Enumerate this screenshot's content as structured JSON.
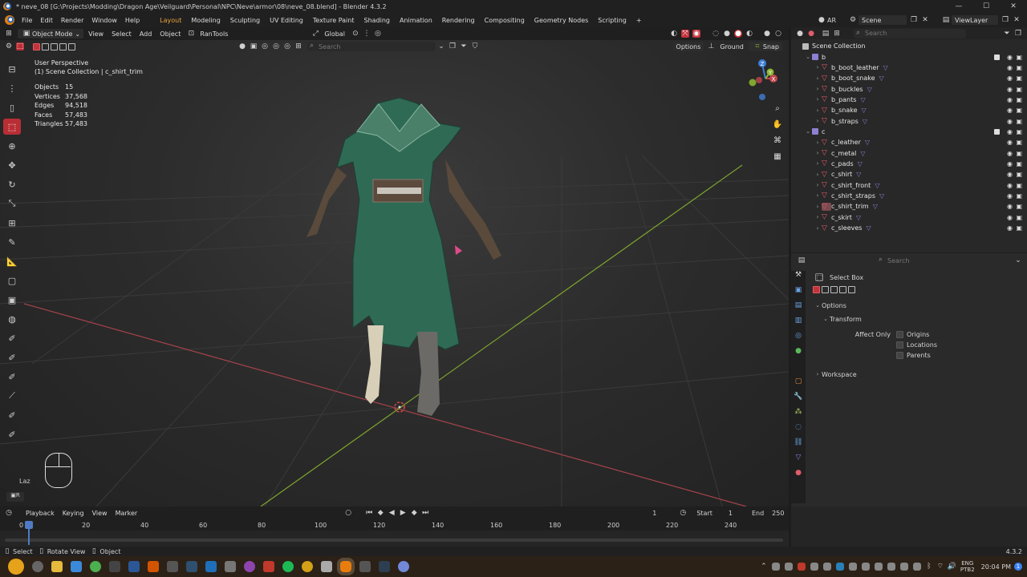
{
  "window": {
    "title": "* neve_08 [G:\\Projects\\Modding\\Dragon Age\\Veilguard\\Personal\\NPC\\Neve\\armor\\08\\neve_08.blend] - Blender 4.3.2",
    "min": "—",
    "max": "☐",
    "close": "✕"
  },
  "menu": [
    "File",
    "Edit",
    "Render",
    "Window",
    "Help"
  ],
  "workspaces": [
    "Layout",
    "Modeling",
    "Sculpting",
    "UV Editing",
    "Texture Paint",
    "Shading",
    "Animation",
    "Rendering",
    "Compositing",
    "Geometry Nodes",
    "Scripting"
  ],
  "active_workspace": "Layout",
  "add_workspace": "+",
  "scene": {
    "ar": "AR",
    "name": "Scene",
    "view_layer": "ViewLayer"
  },
  "viewport_header": {
    "mode": "Object Mode",
    "menus": [
      "View",
      "Select",
      "Add",
      "Object"
    ],
    "addon": "RanTools",
    "orientation": "Global",
    "options": "Options",
    "ground": "Ground",
    "snap": "Snap",
    "search_placeholder": "Search"
  },
  "overlay": {
    "view": "User Perspective",
    "collection": "(1) Scene Collection | c_shirt_trim"
  },
  "stats": [
    {
      "k": "Objects",
      "v": "15"
    },
    {
      "k": "Vertices",
      "v": "37,568"
    },
    {
      "k": "Edges",
      "v": "94,518"
    },
    {
      "k": "Faces",
      "v": "57,483"
    },
    {
      "k": "Triangles",
      "v": "57,483"
    }
  ],
  "gizmo": {
    "x": "X",
    "y": "Y",
    "z": "Z"
  },
  "laz_label": "Laz",
  "outliner": {
    "search_placeholder": "Search",
    "root": "Scene Collection",
    "collections": [
      {
        "name": "b",
        "items": [
          "b_boot_leather",
          "b_boot_snake",
          "b_buckles",
          "b_pants",
          "b_snake",
          "b_straps"
        ]
      },
      {
        "name": "c",
        "items": [
          "c_leather",
          "c_metal",
          "c_pads",
          "c_shirt",
          "c_shirt_front",
          "c_shirt_straps",
          "c_shirt_trim",
          "c_skirt",
          "c_sleeves"
        ]
      }
    ],
    "selected": "c_shirt_trim"
  },
  "properties": {
    "search_placeholder": "Search",
    "tool": "Select Box",
    "options": "Options",
    "transform": "Transform",
    "affect_only": "Affect Only",
    "checks": [
      "Origins",
      "Locations",
      "Parents"
    ],
    "workspace": "Workspace"
  },
  "timeline": {
    "playback": "Playback",
    "keying": "Keying",
    "view": "View",
    "marker": "Marker",
    "current_frame": "1",
    "start_label": "Start",
    "start": "1",
    "end_label": "End",
    "end": "250",
    "ticks": [
      "0",
      "20",
      "40",
      "60",
      "80",
      "100",
      "120",
      "140",
      "160",
      "180",
      "200",
      "220",
      "240"
    ]
  },
  "statusbar": {
    "select": "Select",
    "rotate": "Rotate View",
    "object": "Object",
    "version": "4.3.2"
  },
  "taskbar": {
    "lang": "ENG",
    "layout": "PTB2",
    "time": "20:04 PM",
    "date": "",
    "badge": "1"
  },
  "colors": {
    "accent": "#e8a33a",
    "select_red": "#c3333c",
    "mesh": "#e05c6a",
    "collection": "#8f7fd2",
    "x_axis": "#c2464f",
    "y_axis": "#8ab52f",
    "z_axis": "#3d7ed6"
  }
}
